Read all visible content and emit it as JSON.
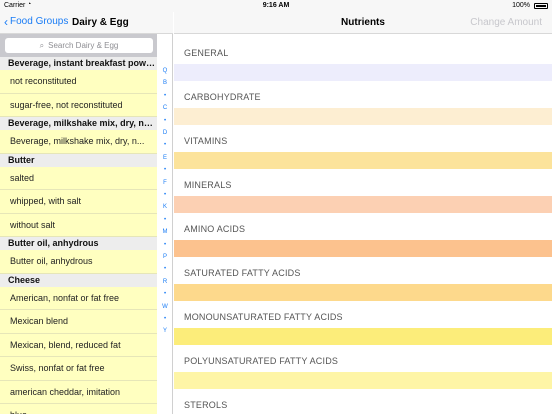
{
  "status_bar": {
    "carrier": "Carrier",
    "time": "9:16 AM",
    "battery": "100%"
  },
  "left_nav": {
    "back_label": "Food Groups",
    "title": "Dairy & Egg"
  },
  "search": {
    "placeholder": "Search Dairy & Egg"
  },
  "food_list": [
    {
      "kind": "header",
      "text": "Beverage, instant breakfast powd..."
    },
    {
      "kind": "row",
      "text": "not reconstituted"
    },
    {
      "kind": "row",
      "text": "sugar-free, not reconstituted"
    },
    {
      "kind": "header",
      "text": "Beverage, milkshake mix, dry, not..."
    },
    {
      "kind": "row",
      "text": "Beverage, milkshake mix, dry, n..."
    },
    {
      "kind": "header",
      "text": "Butter"
    },
    {
      "kind": "row",
      "text": "salted"
    },
    {
      "kind": "row",
      "text": "whipped, with salt"
    },
    {
      "kind": "row",
      "text": "without salt"
    },
    {
      "kind": "header",
      "text": "Butter oil, anhydrous"
    },
    {
      "kind": "row",
      "text": "Butter oil, anhydrous"
    },
    {
      "kind": "header",
      "text": "Cheese"
    },
    {
      "kind": "row",
      "text": "American, nonfat or fat free"
    },
    {
      "kind": "row",
      "text": "Mexican blend"
    },
    {
      "kind": "row",
      "text": "Mexican, blend, reduced fat"
    },
    {
      "kind": "row",
      "text": "Swiss, nonfat or fat free"
    },
    {
      "kind": "row",
      "text": "american cheddar, imitation"
    },
    {
      "kind": "row",
      "text": "blue"
    }
  ],
  "section_index": [
    "Q",
    "B",
    "•",
    "C",
    "•",
    "D",
    "•",
    "E",
    "•",
    "F",
    "•",
    "K",
    "•",
    "M",
    "•",
    "P",
    "•",
    "R",
    "•",
    "W",
    "•",
    "Y"
  ],
  "right_nav": {
    "title": "Nutrients",
    "action": "Change Amount"
  },
  "nutrient_sections": [
    {
      "label": "GENERAL",
      "color": "#ededfc"
    },
    {
      "label": "CARBOHYDRATE",
      "color": "#fdeed2"
    },
    {
      "label": "VITAMINS",
      "color": "#fce39b"
    },
    {
      "label": "MINERALS",
      "color": "#fcd0b3"
    },
    {
      "label": "AMINO ACIDS",
      "color": "#fcc28e"
    },
    {
      "label": "SATURATED FATTY ACIDS",
      "color": "#fdd98c"
    },
    {
      "label": "MONOUNSATURATED FATTY ACIDS",
      "color": "#fced7a"
    },
    {
      "label": "POLYUNSATURATED FATTY ACIDS",
      "color": "#fef5a6"
    },
    {
      "label": "STEROLS",
      "color": "#fff7c2"
    }
  ],
  "colors": {
    "accent": "#1a7cf5",
    "list_background": "#ffffc0"
  }
}
